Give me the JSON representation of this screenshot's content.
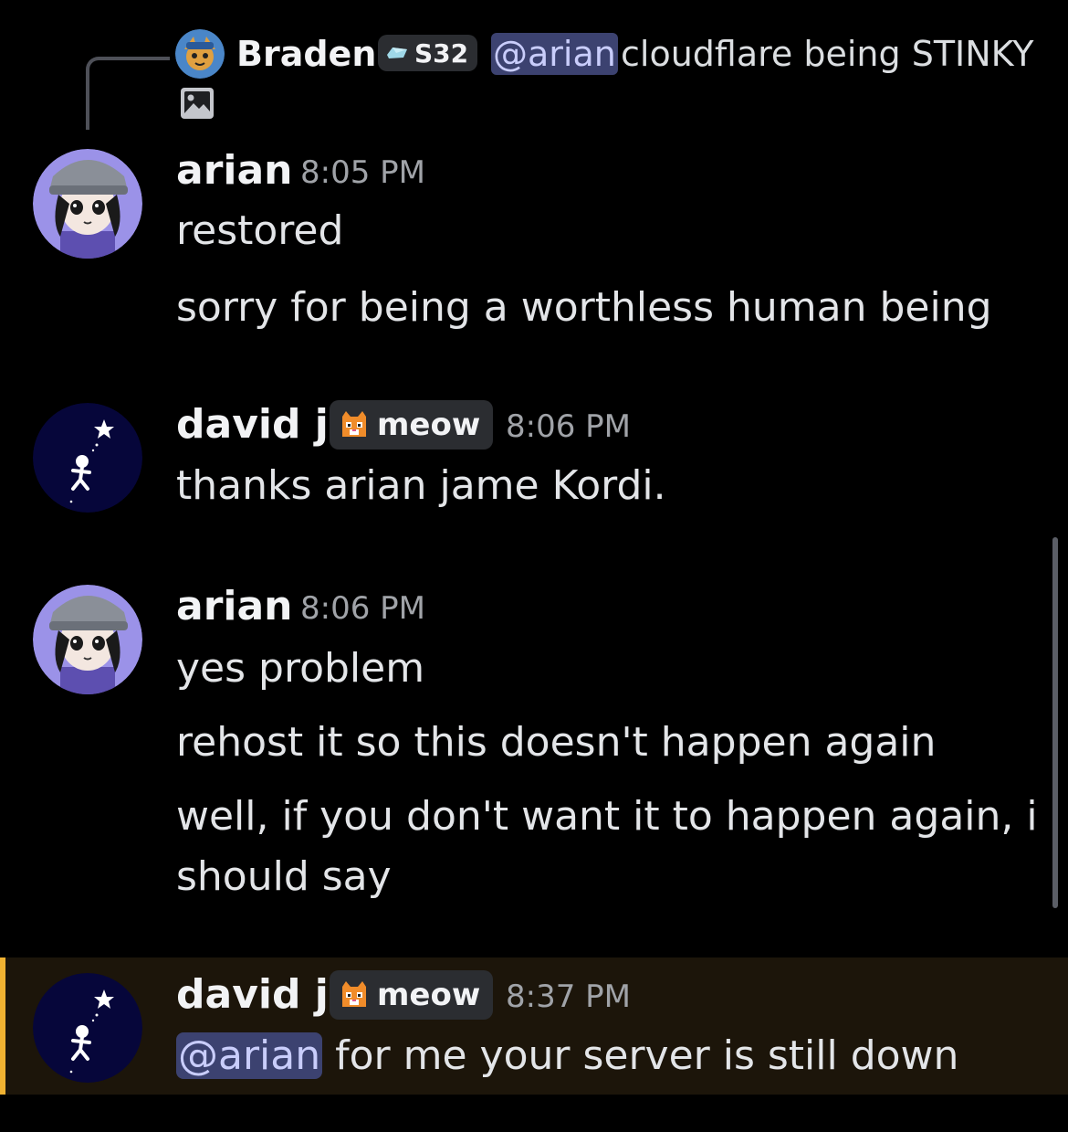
{
  "reply": {
    "author": "Braden",
    "tag": "S32",
    "mention": "@arian",
    "text": "cloudflare being STINKY",
    "attachment_icon": "image-icon"
  },
  "messages": [
    {
      "author": "arian",
      "time": "8:05 PM",
      "avatar": "arian-avatar",
      "lines": [
        "restored",
        "sorry for being a worthless human being"
      ]
    },
    {
      "author": "david j.",
      "tag": "meow",
      "time": "8:06 PM",
      "avatar": "david-avatar",
      "lines": [
        "thanks arian jame Kordi."
      ]
    },
    {
      "author": "arian",
      "time": "8:06 PM",
      "avatar": "arian-avatar",
      "lines": [
        "yes problem",
        "rehost it so this doesn't happen again",
        "well, if you don't want it to happen again, i",
        "should say"
      ]
    },
    {
      "author": "david j.",
      "tag": "meow",
      "time": "8:37 PM",
      "avatar": "david-avatar",
      "mention": "@arian",
      "lines": [
        "for me your server is still down"
      ],
      "highlighted": true
    }
  ],
  "colors": {
    "background": "#000000",
    "mention_bg": "#3c4270",
    "mention_text": "#c9cdfb",
    "highlight_bg": "#1c150a",
    "highlight_bar": "#f0b232",
    "timestamp": "#a0a3a8"
  }
}
